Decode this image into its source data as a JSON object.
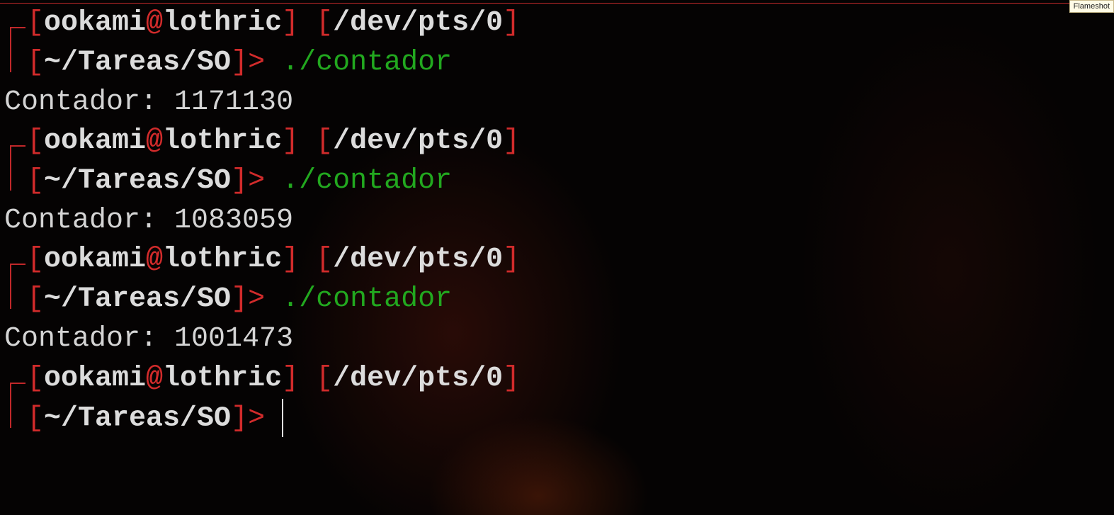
{
  "window": {
    "overlay_label": "Flameshot"
  },
  "prompt": {
    "user": "ookami",
    "at": "@",
    "host": "lothric",
    "tty": "/dev/pts/0",
    "cwd": "~/Tareas/SO",
    "arrow": ">",
    "open": "[",
    "close": "]"
  },
  "history": [
    {
      "command": "./contador",
      "output": "Contador: 1171130"
    },
    {
      "command": "./contador",
      "output": "Contador: 1083059"
    },
    {
      "command": "./contador",
      "output": "Contador: 1001473"
    }
  ],
  "colors": {
    "accent": "#d12b2b",
    "command": "#22a81f",
    "text": "#dcdcdc",
    "background": "#050303"
  }
}
